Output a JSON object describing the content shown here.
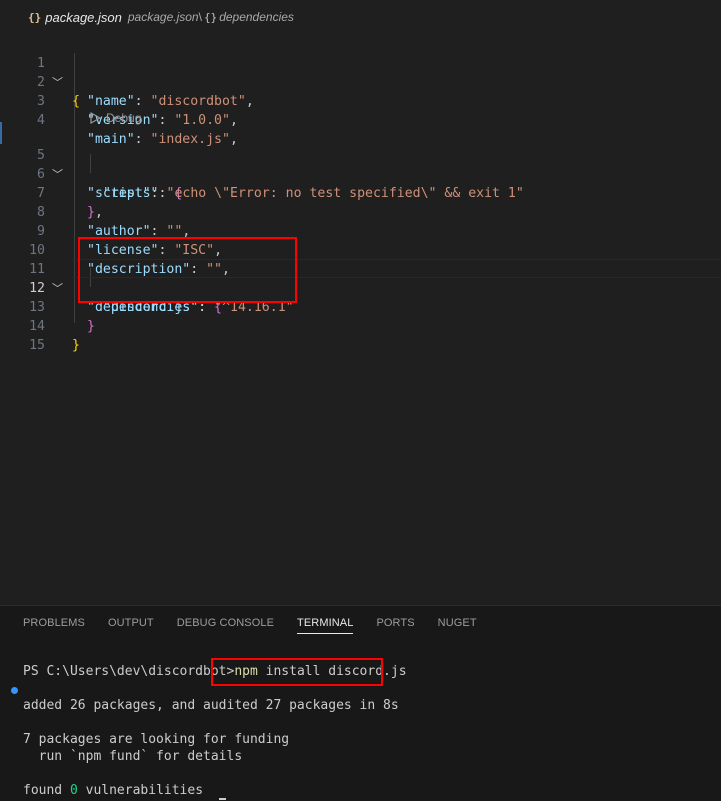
{
  "breadcrumb": {
    "file_icon": "{}",
    "file_name": "package.json",
    "path_file": "package.json",
    "separator": "\\",
    "symbol_icon": "{}",
    "symbol": "dependencies"
  },
  "editor": {
    "active_line": 12,
    "codelens": "Debug",
    "lines": [
      {
        "n": "1"
      },
      {
        "n": "2"
      },
      {
        "n": "3"
      },
      {
        "n": "4"
      },
      {
        "n": "5"
      },
      {
        "n": "6"
      },
      {
        "n": "7"
      },
      {
        "n": "8"
      },
      {
        "n": "9"
      },
      {
        "n": "10"
      },
      {
        "n": "11"
      },
      {
        "n": "12"
      },
      {
        "n": "13"
      },
      {
        "n": "14"
      },
      {
        "n": "15"
      }
    ],
    "tokens": {
      "l1_open": "{",
      "l2_key": "\"name\"",
      "l2_val": "\"discordbot\"",
      "l3_key": "\"version\"",
      "l3_val": "\"1.0.0\"",
      "l4_key": "\"main\"",
      "l4_val": "\"index.js\"",
      "l5_key": "\"scripts\"",
      "l5_open": "{",
      "l6_key": "\"test\"",
      "l6_val": "\"echo \\\"Error: no test specified\\\" && exit 1\"",
      "l7_close": "}",
      "l8_key": "\"author\"",
      "l8_val": "\"\"",
      "l9_key": "\"license\"",
      "l9_val": "\"ISC\"",
      "l10_key": "\"description\"",
      "l10_val": "\"\"",
      "l11_key": "\"dependencies\"",
      "l11_open": "{",
      "l12_key": "\"discord.js\"",
      "l12_val": "\"^14.16.1\"",
      "l13_close": "}",
      "l14_close": "}",
      "colon": ": ",
      "comma": ","
    }
  },
  "panel": {
    "tabs": [
      "PROBLEMS",
      "OUTPUT",
      "DEBUG CONSOLE",
      "TERMINAL",
      "PORTS",
      "NUGET"
    ],
    "active_tab": "TERMINAL",
    "terminal": {
      "prompt": "PS C:\\Users\\dev\\discordbot>",
      "cmd_npm": "npm",
      "cmd_rest": " install discord.js",
      "out1": "added 26 packages, and audited 27 packages in 8s",
      "out2": "7 packages are looking for funding",
      "out3": "  run `npm fund` for details",
      "out4_a": "found ",
      "out4_zero": "0",
      "out4_b": " vulnerabilities"
    }
  },
  "colors": {
    "highlight_box": "#ff0000",
    "key": "#9cdcfe",
    "string": "#ce9178"
  }
}
